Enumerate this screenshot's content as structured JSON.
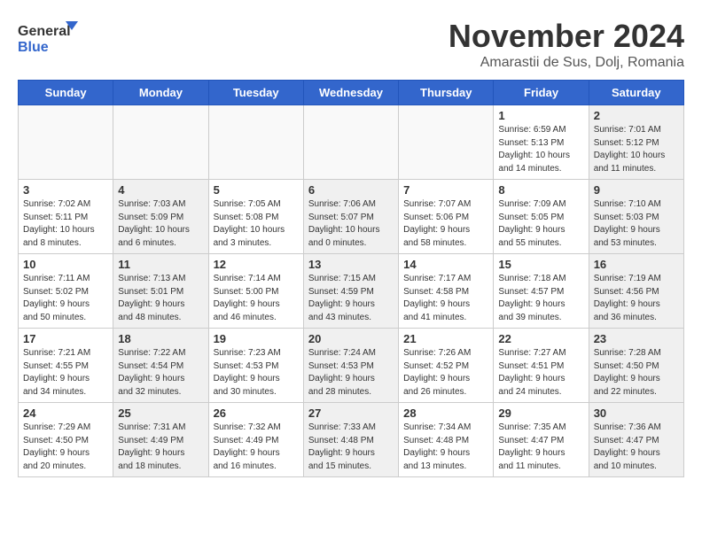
{
  "header": {
    "title": "November 2024",
    "subtitle": "Amarastii de Sus, Dolj, Romania",
    "logo_general": "General",
    "logo_blue": "Blue"
  },
  "days_of_week": [
    "Sunday",
    "Monday",
    "Tuesday",
    "Wednesday",
    "Thursday",
    "Friday",
    "Saturday"
  ],
  "weeks": [
    [
      {
        "day": "",
        "info": "",
        "empty": true
      },
      {
        "day": "",
        "info": "",
        "empty": true
      },
      {
        "day": "",
        "info": "",
        "empty": true
      },
      {
        "day": "",
        "info": "",
        "empty": true
      },
      {
        "day": "",
        "info": "",
        "empty": true
      },
      {
        "day": "1",
        "info": "Sunrise: 6:59 AM\nSunset: 5:13 PM\nDaylight: 10 hours\nand 14 minutes.",
        "shaded": false
      },
      {
        "day": "2",
        "info": "Sunrise: 7:01 AM\nSunset: 5:12 PM\nDaylight: 10 hours\nand 11 minutes.",
        "shaded": true
      }
    ],
    [
      {
        "day": "3",
        "info": "Sunrise: 7:02 AM\nSunset: 5:11 PM\nDaylight: 10 hours\nand 8 minutes.",
        "shaded": false
      },
      {
        "day": "4",
        "info": "Sunrise: 7:03 AM\nSunset: 5:09 PM\nDaylight: 10 hours\nand 6 minutes.",
        "shaded": true
      },
      {
        "day": "5",
        "info": "Sunrise: 7:05 AM\nSunset: 5:08 PM\nDaylight: 10 hours\nand 3 minutes.",
        "shaded": false
      },
      {
        "day": "6",
        "info": "Sunrise: 7:06 AM\nSunset: 5:07 PM\nDaylight: 10 hours\nand 0 minutes.",
        "shaded": true
      },
      {
        "day": "7",
        "info": "Sunrise: 7:07 AM\nSunset: 5:06 PM\nDaylight: 9 hours\nand 58 minutes.",
        "shaded": false
      },
      {
        "day": "8",
        "info": "Sunrise: 7:09 AM\nSunset: 5:05 PM\nDaylight: 9 hours\nand 55 minutes.",
        "shaded": false
      },
      {
        "day": "9",
        "info": "Sunrise: 7:10 AM\nSunset: 5:03 PM\nDaylight: 9 hours\nand 53 minutes.",
        "shaded": true
      }
    ],
    [
      {
        "day": "10",
        "info": "Sunrise: 7:11 AM\nSunset: 5:02 PM\nDaylight: 9 hours\nand 50 minutes.",
        "shaded": false
      },
      {
        "day": "11",
        "info": "Sunrise: 7:13 AM\nSunset: 5:01 PM\nDaylight: 9 hours\nand 48 minutes.",
        "shaded": true
      },
      {
        "day": "12",
        "info": "Sunrise: 7:14 AM\nSunset: 5:00 PM\nDaylight: 9 hours\nand 46 minutes.",
        "shaded": false
      },
      {
        "day": "13",
        "info": "Sunrise: 7:15 AM\nSunset: 4:59 PM\nDaylight: 9 hours\nand 43 minutes.",
        "shaded": true
      },
      {
        "day": "14",
        "info": "Sunrise: 7:17 AM\nSunset: 4:58 PM\nDaylight: 9 hours\nand 41 minutes.",
        "shaded": false
      },
      {
        "day": "15",
        "info": "Sunrise: 7:18 AM\nSunset: 4:57 PM\nDaylight: 9 hours\nand 39 minutes.",
        "shaded": false
      },
      {
        "day": "16",
        "info": "Sunrise: 7:19 AM\nSunset: 4:56 PM\nDaylight: 9 hours\nand 36 minutes.",
        "shaded": true
      }
    ],
    [
      {
        "day": "17",
        "info": "Sunrise: 7:21 AM\nSunset: 4:55 PM\nDaylight: 9 hours\nand 34 minutes.",
        "shaded": false
      },
      {
        "day": "18",
        "info": "Sunrise: 7:22 AM\nSunset: 4:54 PM\nDaylight: 9 hours\nand 32 minutes.",
        "shaded": true
      },
      {
        "day": "19",
        "info": "Sunrise: 7:23 AM\nSunset: 4:53 PM\nDaylight: 9 hours\nand 30 minutes.",
        "shaded": false
      },
      {
        "day": "20",
        "info": "Sunrise: 7:24 AM\nSunset: 4:53 PM\nDaylight: 9 hours\nand 28 minutes.",
        "shaded": true
      },
      {
        "day": "21",
        "info": "Sunrise: 7:26 AM\nSunset: 4:52 PM\nDaylight: 9 hours\nand 26 minutes.",
        "shaded": false
      },
      {
        "day": "22",
        "info": "Sunrise: 7:27 AM\nSunset: 4:51 PM\nDaylight: 9 hours\nand 24 minutes.",
        "shaded": false
      },
      {
        "day": "23",
        "info": "Sunrise: 7:28 AM\nSunset: 4:50 PM\nDaylight: 9 hours\nand 22 minutes.",
        "shaded": true
      }
    ],
    [
      {
        "day": "24",
        "info": "Sunrise: 7:29 AM\nSunset: 4:50 PM\nDaylight: 9 hours\nand 20 minutes.",
        "shaded": false
      },
      {
        "day": "25",
        "info": "Sunrise: 7:31 AM\nSunset: 4:49 PM\nDaylight: 9 hours\nand 18 minutes.",
        "shaded": true
      },
      {
        "day": "26",
        "info": "Sunrise: 7:32 AM\nSunset: 4:49 PM\nDaylight: 9 hours\nand 16 minutes.",
        "shaded": false
      },
      {
        "day": "27",
        "info": "Sunrise: 7:33 AM\nSunset: 4:48 PM\nDaylight: 9 hours\nand 15 minutes.",
        "shaded": true
      },
      {
        "day": "28",
        "info": "Sunrise: 7:34 AM\nSunset: 4:48 PM\nDaylight: 9 hours\nand 13 minutes.",
        "shaded": false
      },
      {
        "day": "29",
        "info": "Sunrise: 7:35 AM\nSunset: 4:47 PM\nDaylight: 9 hours\nand 11 minutes.",
        "shaded": false
      },
      {
        "day": "30",
        "info": "Sunrise: 7:36 AM\nSunset: 4:47 PM\nDaylight: 9 hours\nand 10 minutes.",
        "shaded": true
      }
    ]
  ]
}
